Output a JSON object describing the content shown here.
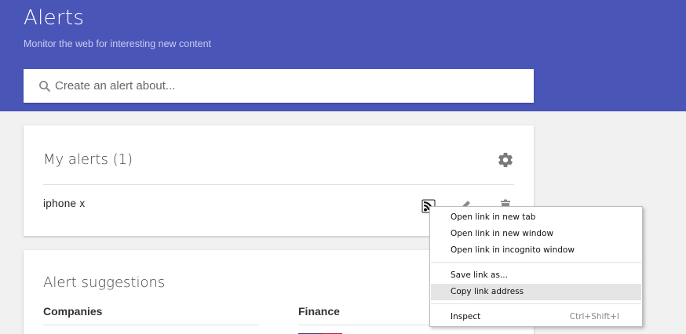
{
  "header": {
    "title": "Alerts",
    "subtitle": "Monitor the web for interesting new content",
    "background_color": "#4a55b8"
  },
  "search": {
    "placeholder": "Create an alert about...",
    "icon": "search-icon"
  },
  "my_alerts": {
    "title": "My alerts (1)",
    "settings_icon": "gear-icon",
    "alerts": [
      {
        "label": "iphone x",
        "actions": [
          "rss-feed-icon",
          "edit-pencil-icon",
          "delete-trash-icon"
        ]
      }
    ]
  },
  "suggestions": {
    "title": "Alert suggestions",
    "sections": [
      "Companies",
      "Finance"
    ]
  },
  "context_menu": {
    "items": [
      {
        "label": "Open link in new tab"
      },
      {
        "label": "Open link in new window"
      },
      {
        "label": "Open link in incognito window"
      },
      {
        "label": "Save link as..."
      },
      {
        "label": "Copy link address",
        "highlighted": true
      },
      {
        "label": "Inspect",
        "shortcut": "Ctrl+Shift+I"
      }
    ]
  }
}
